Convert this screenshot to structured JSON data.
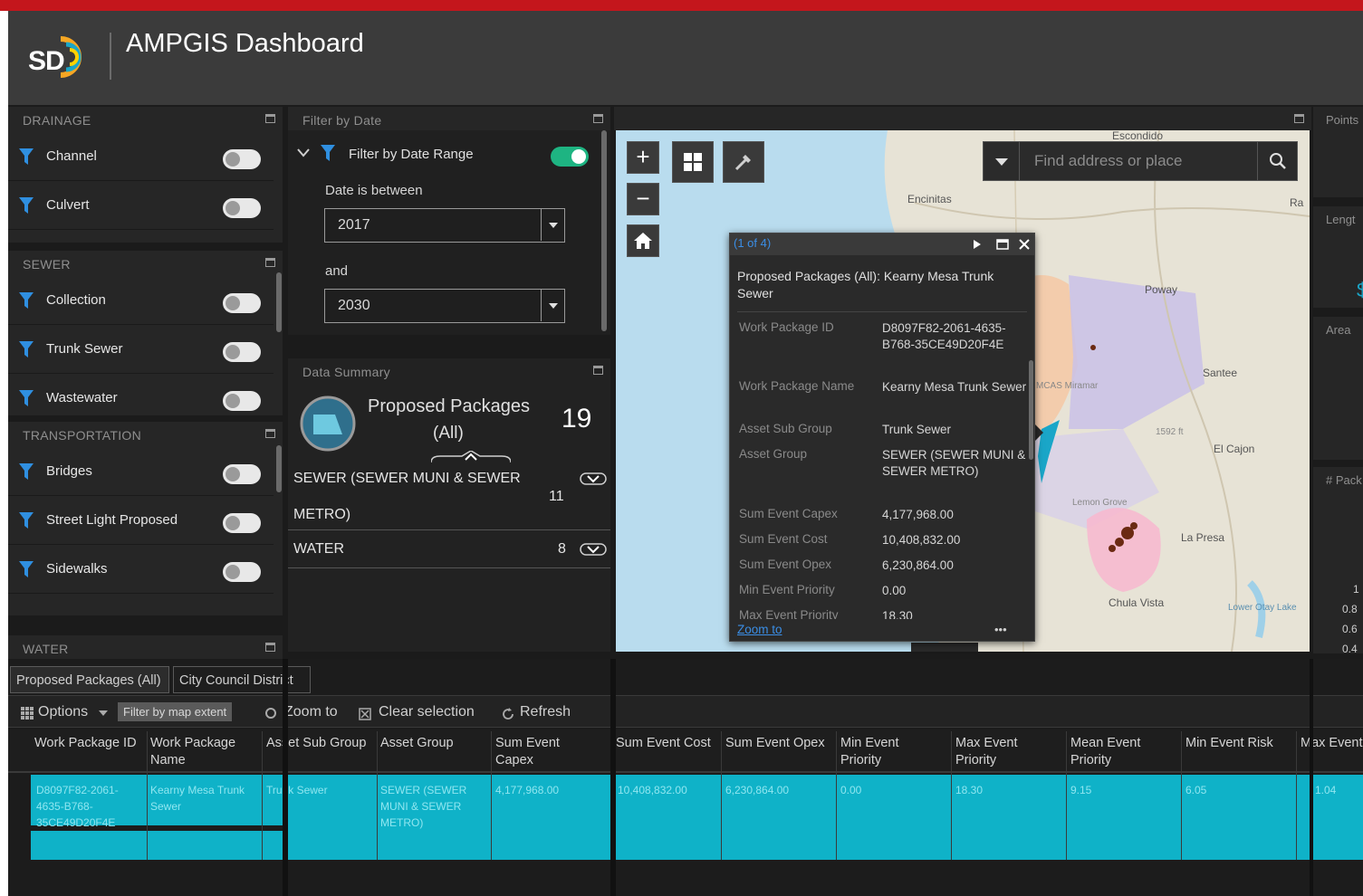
{
  "header": {
    "app_title": "AMPGIS Dashboard",
    "logo_text": "SD"
  },
  "layers_panel": {
    "groups": [
      {
        "title": "DRAINAGE",
        "items": [
          {
            "label": "Channel",
            "on": false
          },
          {
            "label": "Culvert",
            "on": false
          }
        ]
      },
      {
        "title": "SEWER",
        "items": [
          {
            "label": "Collection",
            "on": false
          },
          {
            "label": "Trunk Sewer",
            "on": false
          },
          {
            "label": "Wastewater",
            "on": false
          }
        ]
      },
      {
        "title": "TRANSPORTATION",
        "items": [
          {
            "label": "Bridges",
            "on": false
          },
          {
            "label": "Street Light Proposed",
            "on": false
          },
          {
            "label": "Sidewalks",
            "on": false
          }
        ]
      },
      {
        "title": "WATER",
        "items": []
      }
    ]
  },
  "filter_panel": {
    "title": "Filter by Date",
    "filter_label": "Filter by Date Range",
    "filter_on": true,
    "between_label": "Date is between",
    "start_value": "2017",
    "and_label": "and",
    "end_value": "2030"
  },
  "summary_panel": {
    "title": "Data Summary",
    "package_label_1": "Proposed Packages",
    "package_label_2": "(All)",
    "package_count": "19",
    "rows": [
      {
        "line1": "SEWER (SEWER MUNI & SEWER",
        "line2": "METRO)",
        "count": "11"
      },
      {
        "line1": "WATER",
        "line2": "",
        "count": "8"
      }
    ]
  },
  "map": {
    "search_placeholder": "Find address or place",
    "places": [
      "Escondido",
      "Encinitas",
      "Poway",
      "Santee",
      "El Cajon",
      "La Presa",
      "Chula Vista",
      "MCAS Miramar",
      "Lemon Grove",
      "1592 ft",
      "Lower Otay Lake",
      "Ra"
    ]
  },
  "popup": {
    "count": "(1 of 4)",
    "title": "Proposed Packages (All): Kearny Mesa Trunk Sewer",
    "attributes": [
      {
        "key": "Work Package ID",
        "value": "D8097F82-2061-4635-B768-35CE49D20F4E"
      },
      {
        "key": "Work Package Name",
        "value": "Kearny Mesa Trunk Sewer"
      },
      {
        "key": "Asset Sub Group",
        "value": "Trunk Sewer"
      },
      {
        "key": "Asset Group",
        "value": "SEWER (SEWER MUNI & SEWER METRO)"
      },
      {
        "key": "Sum Event Capex",
        "value": "4,177,968.00"
      },
      {
        "key": "Sum Event Cost",
        "value": "10,408,832.00"
      },
      {
        "key": "Sum Event Opex",
        "value": "6,230,864.00"
      },
      {
        "key": "Min Event Priority",
        "value": "0.00"
      },
      {
        "key": "Max Event Priority",
        "value": "18.30"
      }
    ],
    "zoom_label": "Zoom to",
    "more_label": "•••"
  },
  "right_panel": {
    "labels": [
      "Points",
      "Lengt",
      "Area",
      "# Pack"
    ],
    "ticks": [
      "1",
      "0.8",
      "0.6",
      "0.4"
    ]
  },
  "table": {
    "tabs": [
      "Proposed Packages (All)",
      "City Council District"
    ],
    "toolbar": {
      "options": "Options",
      "filter_extent": "Filter by map extent",
      "zoom_to": "Zoom to",
      "clear_selection": "Clear selection",
      "refresh": "Refresh"
    },
    "columns": [
      "Work Package ID",
      "Work Package Name",
      "Asset Sub Group",
      "Asset Group",
      "Sum Event Capex",
      "Sum Event Cost",
      "Sum Event Opex",
      "Min Event Priority",
      "Max Event Priority",
      "Mean Event Priority",
      "Min Event Risk",
      "Max Event"
    ],
    "row": [
      "D8097F82-2061-4635-B768-35CE49D20F4E",
      "Kearny Mesa Trunk Sewer",
      "Trunk Sewer",
      "SEWER (SEWER MUNI & SEWER METRO)",
      "4,177,968.00",
      "10,408,832.00",
      "6,230,864.00",
      "0.00",
      "18.30",
      "9.15",
      "6.05",
      "1.04"
    ]
  },
  "colors": {
    "accent_red": "#c4161c",
    "toggle_on": "#1eb482",
    "selection": "#0fb2c8",
    "link": "#3a8ee6"
  }
}
